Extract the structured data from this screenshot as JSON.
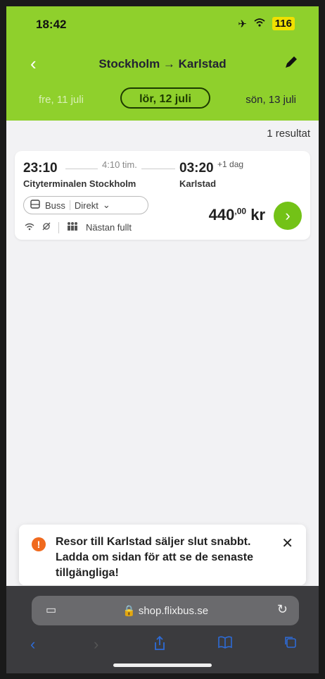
{
  "status": {
    "time": "18:42",
    "battery": "116"
  },
  "header": {
    "title": "Stockholm → Karlstad"
  },
  "dates": {
    "prev": "fre, 11 juli",
    "current": "lör, 12 juli",
    "next": "sön, 13 juli"
  },
  "results": {
    "count_label": "1 resultat"
  },
  "trip": {
    "departure_time": "23:10",
    "duration": "4:10 tim.",
    "arrival_time": "03:20",
    "day_offset": "+1 dag",
    "departure_station": "Cityterminalen Stockholm",
    "arrival_station": "Karlstad",
    "vehicle": "Buss",
    "connection": "Direkt",
    "availability": "Nästan fullt",
    "price_main": "440",
    "price_decimals": ",00",
    "currency": "kr"
  },
  "notice": {
    "text": "Resor till Karlstad säljer slut snabbt. Ladda om sidan för att se de senaste tillgängliga!"
  },
  "browser": {
    "url": "shop.flixbus.se"
  },
  "colors": {
    "brand_green": "#8fd02c",
    "button_green": "#73c217",
    "warning_orange": "#f06a1e",
    "ios_blue": "#2e6bd6"
  }
}
